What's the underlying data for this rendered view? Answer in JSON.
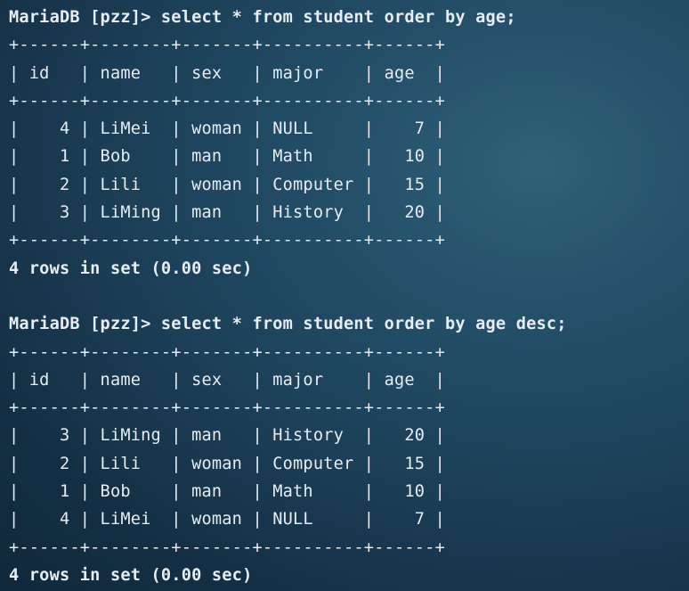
{
  "terminal": {
    "queries": [
      {
        "prompt": "MariaDB [pzz]> select * from student order by age;",
        "border_top": "+------+--------+-------+----------+------+",
        "header": "| id   | name   | sex   | major    | age  |",
        "border_mid": "+------+--------+-------+----------+------+",
        "rows": [
          "|    4 | LiMei  | woman | NULL     |    7 |",
          "|    1 | Bob    | man   | Math     |   10 |",
          "|    2 | Lili   | woman | Computer |   15 |",
          "|    3 | LiMing | man   | History  |   20 |"
        ],
        "border_bottom": "+------+--------+-------+----------+------+",
        "footer": "4 rows in set (0.00 sec)"
      },
      {
        "prompt": "MariaDB [pzz]> select * from student order by age desc;",
        "border_top": "+------+--------+-------+----------+------+",
        "header": "| id   | name   | sex   | major    | age  |",
        "border_mid": "+------+--------+-------+----------+------+",
        "rows": [
          "|    3 | LiMing | man   | History  |   20 |",
          "|    2 | Lili   | woman | Computer |   15 |",
          "|    1 | Bob    | man   | Math     |   10 |",
          "|    4 | LiMei  | woman | NULL     |    7 |"
        ],
        "border_bottom": "+------+--------+-------+----------+------+",
        "footer": "4 rows in set (0.00 sec)"
      }
    ]
  }
}
